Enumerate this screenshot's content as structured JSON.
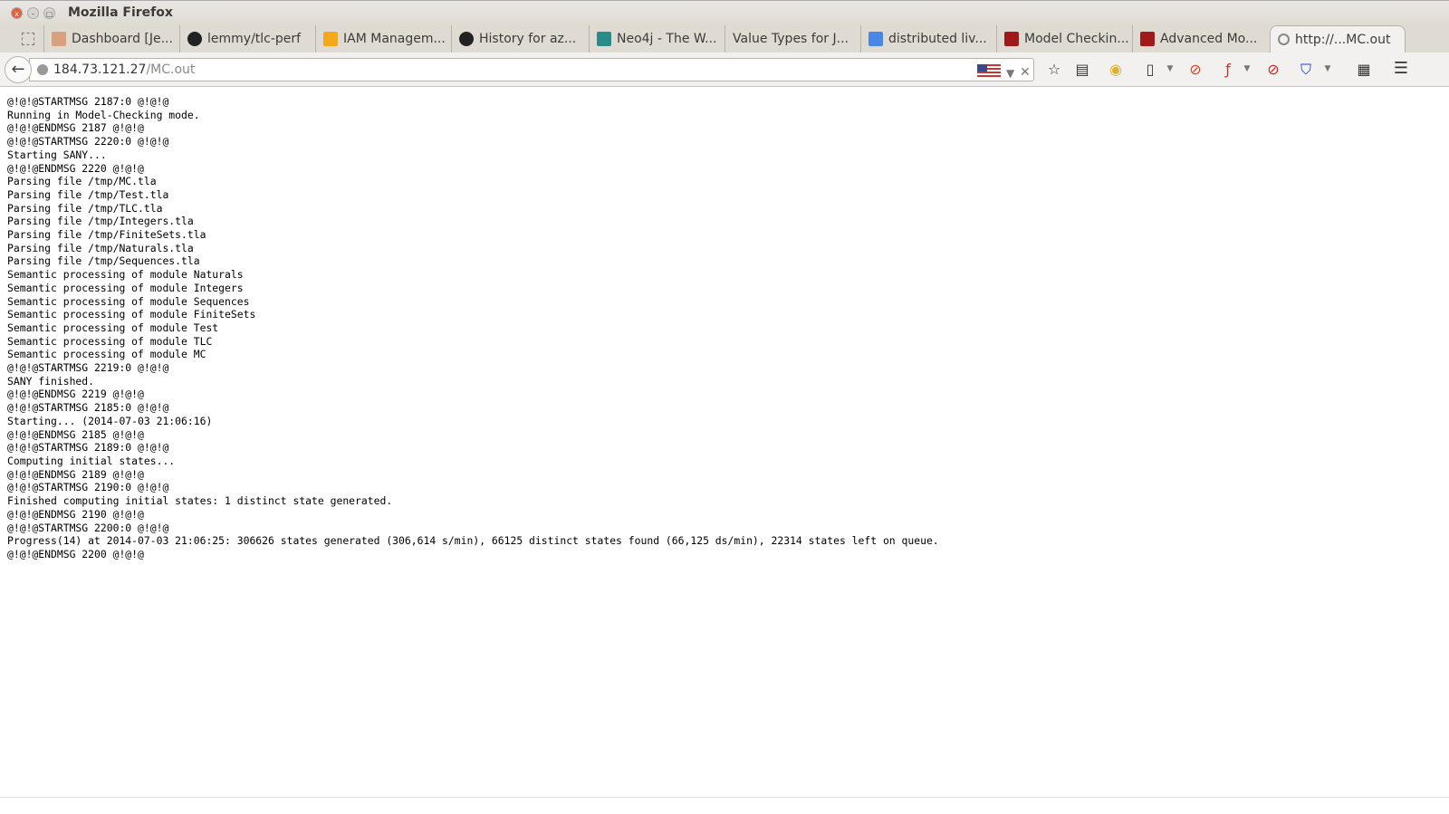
{
  "window": {
    "title": "Mozilla Firefox"
  },
  "tabs": [
    {
      "label": "Dashboard [Je...",
      "icon": "jenkins-icon"
    },
    {
      "label": "lemmy/tlc-perf",
      "icon": "github-icon"
    },
    {
      "label": "IAM Managem...",
      "icon": "aws-icon"
    },
    {
      "label": "History for az...",
      "icon": "github-icon"
    },
    {
      "label": "Neo4j - The W...",
      "icon": "neo4j-icon"
    },
    {
      "label": "Value Types for J...",
      "icon": ""
    },
    {
      "label": "distributed liv...",
      "icon": "google-scholar-icon"
    },
    {
      "label": "Model Checkin...",
      "icon": "tla-icon"
    },
    {
      "label": "Advanced Mo...",
      "icon": "tla-icon"
    },
    {
      "label": "http://...MC.out",
      "icon": "loading-icon",
      "active": true
    }
  ],
  "url": {
    "host": "184.73.121.27",
    "path": "/MC.out"
  },
  "lines": [
    "@!@!@STARTMSG 2187:0 @!@!@",
    "Running in Model-Checking mode.",
    "@!@!@ENDMSG 2187 @!@!@",
    "@!@!@STARTMSG 2220:0 @!@!@",
    "Starting SANY...",
    "@!@!@ENDMSG 2220 @!@!@",
    "Parsing file /tmp/MC.tla",
    "Parsing file /tmp/Test.tla",
    "Parsing file /tmp/TLC.tla",
    "Parsing file /tmp/Integers.tla",
    "Parsing file /tmp/FiniteSets.tla",
    "Parsing file /tmp/Naturals.tla",
    "Parsing file /tmp/Sequences.tla",
    "Semantic processing of module Naturals",
    "Semantic processing of module Integers",
    "Semantic processing of module Sequences",
    "Semantic processing of module FiniteSets",
    "Semantic processing of module Test",
    "Semantic processing of module TLC",
    "Semantic processing of module MC",
    "@!@!@STARTMSG 2219:0 @!@!@",
    "SANY finished.",
    "@!@!@ENDMSG 2219 @!@!@",
    "@!@!@STARTMSG 2185:0 @!@!@",
    "Starting... (2014-07-03 21:06:16)",
    "@!@!@ENDMSG 2185 @!@!@",
    "@!@!@STARTMSG 2189:0 @!@!@",
    "Computing initial states...",
    "@!@!@ENDMSG 2189 @!@!@",
    "@!@!@STARTMSG 2190:0 @!@!@",
    "Finished computing initial states: 1 distinct state generated.",
    "@!@!@ENDMSG 2190 @!@!@",
    "@!@!@STARTMSG 2200:0 @!@!@",
    "Progress(14) at 2014-07-03 21:06:25: 306626 states generated (306,614 s/min), 66125 distinct states found (66,125 ds/min), 22314 states left on queue.",
    "@!@!@ENDMSG 2200 @!@!@"
  ]
}
